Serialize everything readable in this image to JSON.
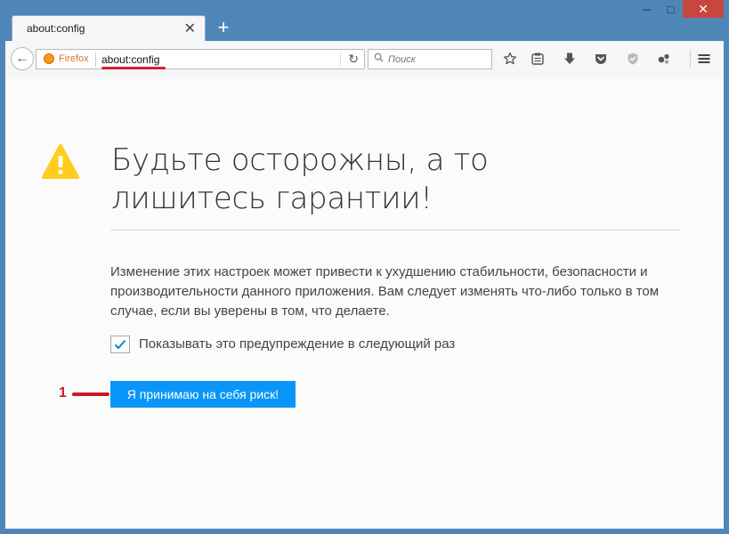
{
  "window": {
    "controls": {
      "minimize": "─",
      "maximize": "□",
      "close": "✕"
    }
  },
  "tab": {
    "title": "about:config",
    "close": "✕",
    "new_tab": "+"
  },
  "navbar": {
    "back": "←",
    "identity_label": "Firefox",
    "url": "about:config",
    "reload": "↻",
    "search_placeholder": "Поиск",
    "icons": [
      "bookmark-star-icon",
      "reading-list-icon",
      "download-icon",
      "pocket-icon",
      "shield-icon",
      "extension-icon",
      "menu-icon"
    ]
  },
  "content": {
    "heading": "Будьте осторожны, а то лишитесь гарантии!",
    "body": "Изменение этих настроек может привести к ухудшению стабильности, безопасности и производительности данного приложения. Вам следует изменять что-либо только в том случае, если вы уверены в том, что делаете.",
    "checkbox_checked": true,
    "checkbox_label": "Показывать это предупреждение в следующий раз",
    "accept_button": "Я принимаю на себя риск!"
  },
  "annotation": {
    "number": "1"
  },
  "colors": {
    "accent": "#0996f8",
    "warning": "#ffcd1f",
    "annotation": "#c8192c",
    "frame": "#4f86b8"
  }
}
